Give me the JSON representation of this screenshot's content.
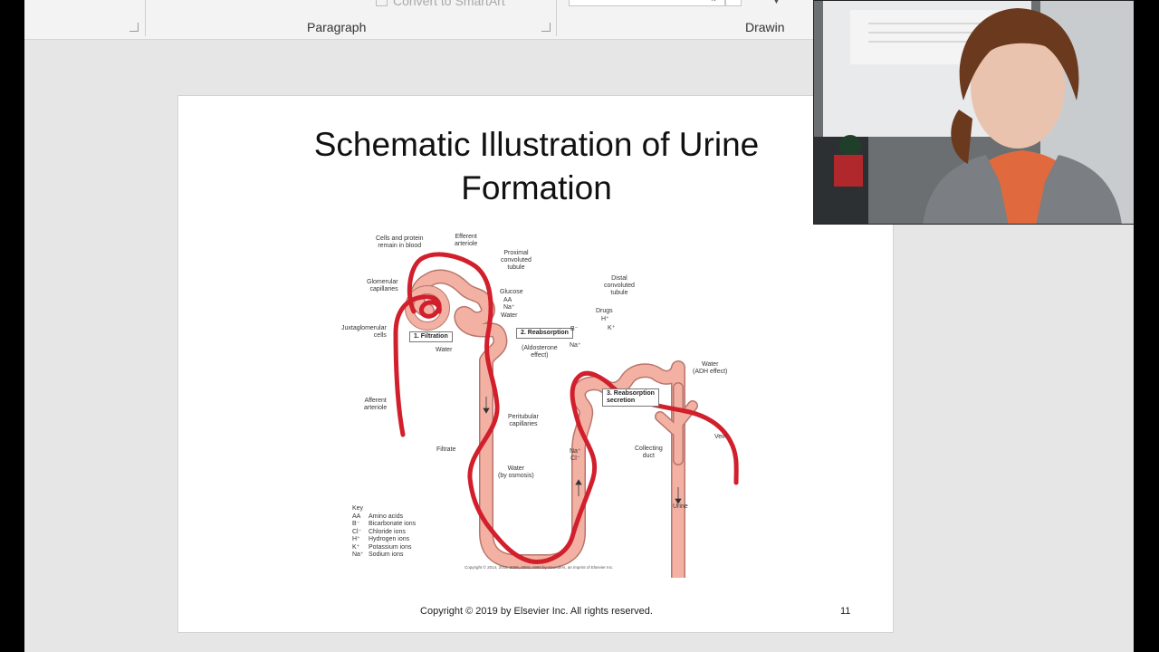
{
  "ribbon": {
    "paragraph_label": "Paragraph",
    "drawing_label": "Drawin",
    "convert_smartart_label": "Convert to SmartArt"
  },
  "slide": {
    "title_line1": "Schematic Illustration of Urine",
    "title_line2": "Formation",
    "footer": "Copyright © 2019 by Elsevier Inc. All rights reserved.",
    "slide_number": "11"
  },
  "diagram": {
    "labels": {
      "cells_protein": "Cells and protein\nremain in blood",
      "efferent_arteriole": "Efferent\narteriole",
      "proximal_tubule": "Proximal\nconvoluted\ntubule",
      "glomerular_capillaries": "Glomerular\ncapillaries",
      "glucose": "Glucose",
      "aa": "AA",
      "na": "Na⁺",
      "water_top": "Water",
      "juxtaglomerular": "Juxtaglomerular\ncells",
      "water_filtration": "Water",
      "aldosterone": "(Aldosterone\neffect)",
      "b_ion": "B⁻",
      "na_ion": "Na⁺",
      "distal_tubule": "Distal\nconvoluted\ntubule",
      "drugs": "Drugs",
      "h_ion": "H⁺",
      "k_ion": "K⁺",
      "water_adh": "Water\n(ADH effect)",
      "afferent_arteriole": "Afferent\narteriole",
      "peritubular": "Peritubular\ncapillaries",
      "filtrate": "Filtrate",
      "water_osmosis": "Water\n(by osmosis)",
      "na_cl": "Na⁺\nCl⁻",
      "collecting_duct": "Collecting\nduct",
      "vein": "Vein",
      "urine": "Urine"
    },
    "boxes": {
      "filtration": "1. Filtration",
      "reabsorption": "2. Reabsorption",
      "reabsorption_secretion": "3. Reabsorption\nsecretion"
    },
    "key_title": "Key",
    "key": [
      {
        "abbr": "AA",
        "meaning": "Amino acids"
      },
      {
        "abbr": "B⁻",
        "meaning": "Bicarbonate ions"
      },
      {
        "abbr": "Cl⁻",
        "meaning": "Chloride ions"
      },
      {
        "abbr": "H⁺",
        "meaning": "Hydrogen ions"
      },
      {
        "abbr": "K⁺",
        "meaning": "Potassium ions"
      },
      {
        "abbr": "Na⁺",
        "meaning": "Sodium ions"
      }
    ],
    "copyright": "Copyright © 2014, 2011, 2006, 2002, 1997 by Saunders, an imprint of Elsevier Inc."
  },
  "colors": {
    "vessel_red": "#d21f2c",
    "tubule_pink": "#f3b1a4",
    "tubule_outline": "#b8766b"
  }
}
